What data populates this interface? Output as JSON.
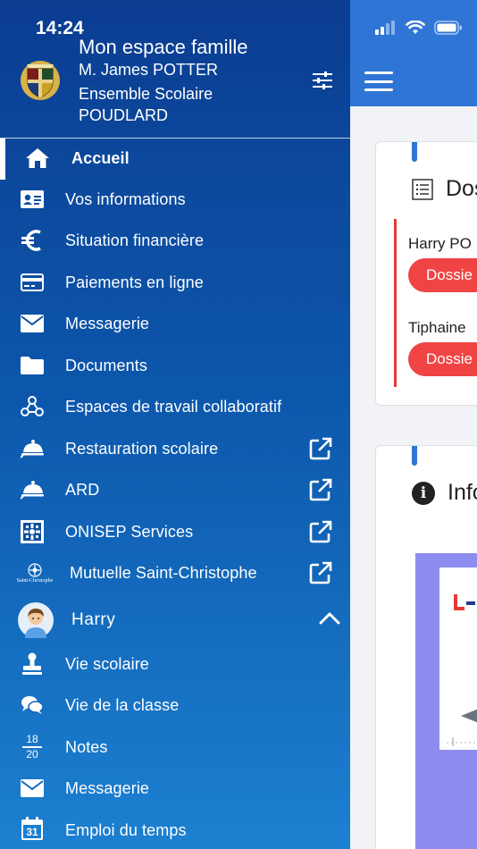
{
  "status_bar": {
    "time": "14:24"
  },
  "drawer": {
    "header": {
      "title": "Mon espace famille",
      "user": "M. James POTTER",
      "school_line1": "Ensemble Scolaire",
      "school_line2": "POUDLARD",
      "logo_icon": "school-crest-icon",
      "settings_icon": "sliders-icon"
    },
    "nav": [
      {
        "label": "Accueil",
        "icon": "home-icon",
        "active": true
      },
      {
        "label": "Vos informations",
        "icon": "id-card-icon"
      },
      {
        "label": "Situation financière",
        "icon": "euro-icon"
      },
      {
        "label": "Paiements en ligne",
        "icon": "credit-card-icon"
      },
      {
        "label": "Messagerie",
        "icon": "envelope-icon"
      },
      {
        "label": "Documents",
        "icon": "folder-icon"
      },
      {
        "label": "Espaces de travail collaboratif",
        "icon": "network-icon"
      },
      {
        "label": "Restauration scolaire",
        "icon": "cloche-icon",
        "external": true
      },
      {
        "label": "ARD",
        "icon": "cloche-icon",
        "external": true
      },
      {
        "label": "ONISEP Services",
        "icon": "onisep-icon",
        "external": true
      },
      {
        "label": "Mutuelle Saint-Christophe",
        "icon": "saint-christophe-logo",
        "external": true
      }
    ],
    "child": {
      "name": "Harry",
      "icon": "avatar-icon",
      "expanded": true
    },
    "child_nav": [
      {
        "label": "Vie scolaire",
        "icon": "stamp-icon"
      },
      {
        "label": "Vie de la classe",
        "icon": "chat-icon"
      },
      {
        "label": "Notes",
        "icon": "grade-fraction-icon",
        "icon_text_top": "18",
        "icon_text_bottom": "20"
      },
      {
        "label": "Messagerie",
        "icon": "envelope-icon"
      },
      {
        "label": "Emploi du temps",
        "icon": "calendar-icon",
        "icon_text": "31"
      }
    ],
    "saint_christophe_logo_text": "Saint-Christophe"
  },
  "main": {
    "dossiers_card": {
      "title": "Dos",
      "students": [
        {
          "name": "Harry PO",
          "button": "Dossie"
        },
        {
          "name": "Tiphaine",
          "button": "Dossie"
        }
      ]
    },
    "info_card": {
      "title": "Info",
      "icon": "info-icon"
    }
  },
  "colors": {
    "drawer_top": "#0b3d91",
    "drawer_bottom": "#1c80d0",
    "topbar": "#2f75d6",
    "dossier_button": "#f04444",
    "accent_red": "#e53935"
  }
}
